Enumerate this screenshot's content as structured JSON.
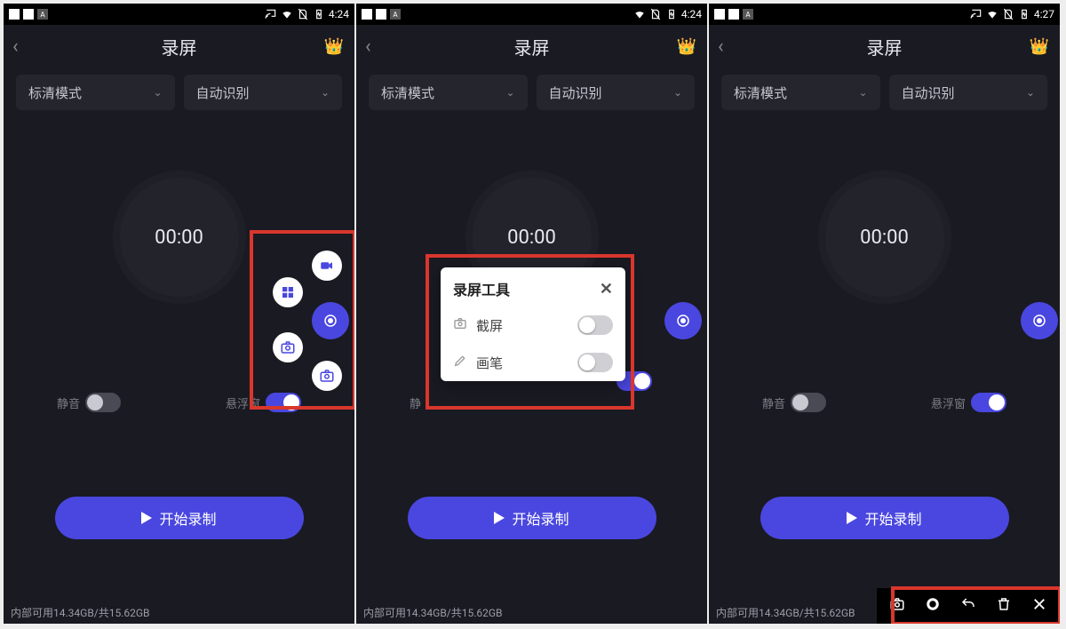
{
  "status": {
    "time1": "4:24",
    "time2": "4:24",
    "time3": "4:27"
  },
  "title": "录屏",
  "dropdowns": {
    "mode": "标清模式",
    "detect": "自动识别"
  },
  "timer": "00:00",
  "toggles": {
    "mute": "静音",
    "float": "悬浮窗"
  },
  "startLabel": "开始录制",
  "storage": "内部可用14.34GB/共15.62GB",
  "dialog": {
    "title": "录屏工具",
    "item1": "截屏",
    "item2": "画笔"
  }
}
